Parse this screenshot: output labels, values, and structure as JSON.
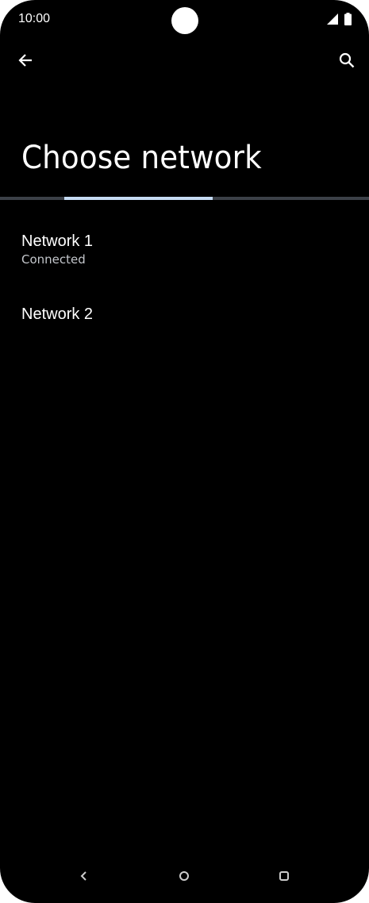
{
  "status_bar": {
    "time": "10:00",
    "icons": [
      "camera-cutout",
      "signal-icon",
      "battery-icon"
    ]
  },
  "app_bar": {
    "back_icon": "arrow-back-icon",
    "search_icon": "search-icon"
  },
  "page": {
    "title": "Choose network",
    "progress_indicator": "indeterminate"
  },
  "networks": [
    {
      "name": "Network 1",
      "status": "Connected"
    },
    {
      "name": "Network 2",
      "status": ""
    }
  ],
  "nav_bar": {
    "icons": [
      "nav-back-icon",
      "nav-home-icon",
      "nav-recents-icon"
    ]
  },
  "colors": {
    "background": "#000000",
    "text_primary": "#ffffff",
    "text_secondary": "#c4c7cc",
    "progress_track": "#3c4148",
    "progress_indicator": "#c6dcf4"
  }
}
